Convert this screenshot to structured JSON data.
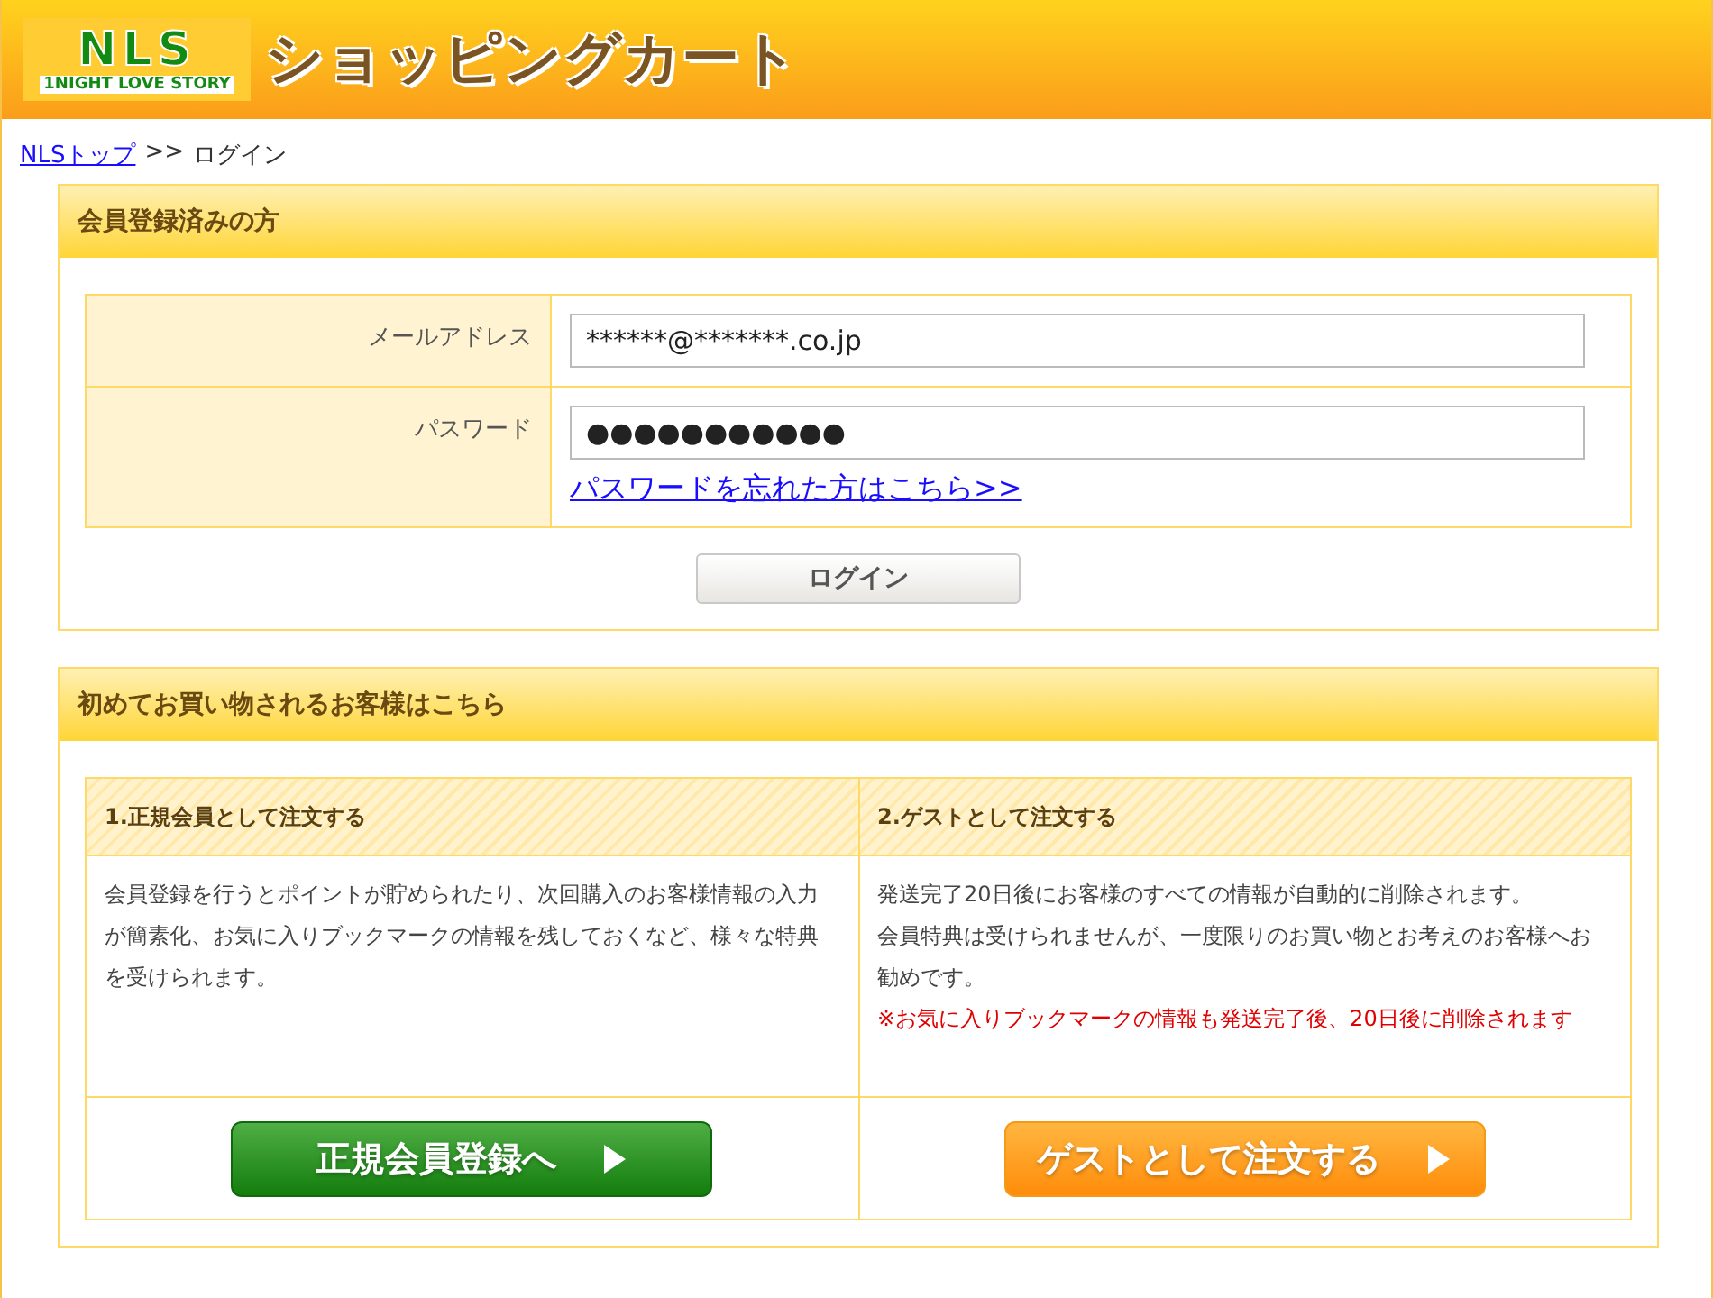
{
  "header": {
    "logo": {
      "mark": "NLS",
      "tagline": "1NIGHT LOVE STORY"
    },
    "title": "ショッピングカート"
  },
  "breadcrumb": {
    "link": "NLSトップ",
    "separator": ">>",
    "current": "ログイン"
  },
  "member_login": {
    "title": "会員登録済みの方",
    "fields": [
      {
        "label": "メールアドレス",
        "value": "******@*******.co.jp"
      },
      {
        "label": "パスワード",
        "value": "●●●●●●●●●●●",
        "link": "パスワードを忘れた方はこちら>>"
      }
    ],
    "button": "ログイン"
  },
  "first_time": {
    "title": "初めてお買い物されるお客様はこちら",
    "options": [
      {
        "kind": "member",
        "heading": "1.正規会員として注文する",
        "lines": [
          "会員登録を行うとポイントが貯められたり、次回購入のお客様情報の入力が簡素化、お気に入りブックマークの情報を残しておくなど、様々な特典を受けられます。"
        ],
        "button": "正規会員登録へ"
      },
      {
        "kind": "guest",
        "heading": "2.ゲストとして注文する",
        "lines": [
          "発送完了20日後にお客様のすべての情報が自動的に削除されます。",
          "会員特典は受けられませんが、一度限りのお買い物とお考えのお客様へお勧めです。"
        ],
        "note": "※お気に入りブックマークの情報も発送完了後、20日後に削除されます",
        "button": "ゲストとして注文する"
      }
    ]
  }
}
